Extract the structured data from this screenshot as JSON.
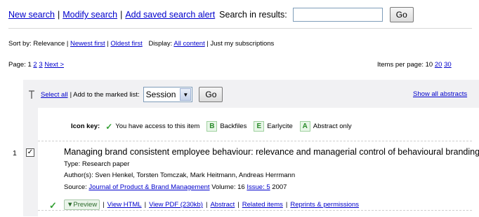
{
  "top": {
    "new_search": "New search",
    "modify_search": "Modify search",
    "add_alert": "Add saved search alert",
    "search_in_results_label": "Search in results:",
    "search_value": "",
    "go_label": "Go"
  },
  "sort": {
    "label": "Sort by: Relevance |",
    "newest": "Newest first",
    "oldest": "Oldest first",
    "display_label": "Display:",
    "all_content": "All content",
    "subs": "| Just my subscriptions"
  },
  "pager": {
    "label": "Page: 1",
    "p2": "2",
    "p3": "3",
    "next": "Next >",
    "per_page_label": "Items per page: 10",
    "pp20": "20",
    "pp30": "30"
  },
  "toolbar": {
    "select_all": "Select all",
    "add_to_list": "| Add to the marked list:",
    "session_value": "Session",
    "go_label": "Go",
    "show_all": "Show all abstracts"
  },
  "icon_key": {
    "label": "Icon key:",
    "access_text": "You have access to this item",
    "b_badge": "B",
    "b_text": "Backfiles",
    "e_badge": "E",
    "e_text": "Earlycite",
    "a_badge": "A",
    "a_text": "Abstract only"
  },
  "result": {
    "number": "1",
    "title": "Managing brand consistent employee behaviour: relevance and managerial control of behavioural branding",
    "type": "Type: Research paper",
    "authors": "Author(s): Sven Henkel, Torsten Tomczak, Mark Heitmann, Andreas Herrmann",
    "source_label": "Source:",
    "journal": "Journal of Product & Brand Management",
    "volume": "Volume: 16",
    "issue": "Issue: 5",
    "year": "2007",
    "preview": "▼Preview",
    "view_html": "View HTML",
    "view_pdf": "View PDF (230kb)",
    "abstract": "Abstract",
    "related": "Related items",
    "reprints": "Reprints & permissions"
  },
  "colors": {
    "link": "#0000cc",
    "band": "#f1f1f3",
    "access_green": "#33a033"
  }
}
